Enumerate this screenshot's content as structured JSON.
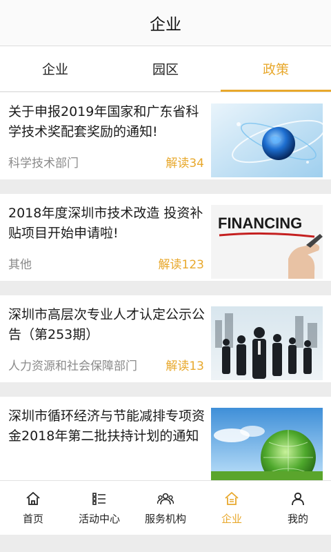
{
  "header": {
    "title": "企业"
  },
  "tabs": [
    {
      "label": "企业",
      "active": false
    },
    {
      "label": "园区",
      "active": false
    },
    {
      "label": "政策",
      "active": true
    }
  ],
  "colors": {
    "accent": "#e8a82c",
    "muted": "#8a8a8a"
  },
  "articles": [
    {
      "title": "关于申报2019年国家和广东省科学技术奖配套奖励的通知!",
      "department": "科学技术部门",
      "reads": "解读34",
      "image": "globe-image"
    },
    {
      "title": "2018年度深圳市技术改造 投资补贴项目开始申请啦!",
      "department": "其他",
      "reads": "解读123",
      "image": "financing-image",
      "image_text": "FINANCING"
    },
    {
      "title": "深圳市高层次专业人才认定公示公告（第253期）",
      "department": "人力资源和社会保障部门",
      "reads": "解读13",
      "image": "business-people-image"
    },
    {
      "title": "深圳市循环经济与节能减排专项资金2018年第二批扶持计划的通知",
      "department": "",
      "reads": "",
      "image": "green-globe-image"
    }
  ],
  "bottom_nav": [
    {
      "label": "首页",
      "icon": "home-icon",
      "active": false
    },
    {
      "label": "活动中心",
      "icon": "list-icon",
      "active": false
    },
    {
      "label": "服务机构",
      "icon": "people-icon",
      "active": false
    },
    {
      "label": "企业",
      "icon": "building-home-icon",
      "active": true
    },
    {
      "label": "我的",
      "icon": "user-icon",
      "active": false
    }
  ]
}
